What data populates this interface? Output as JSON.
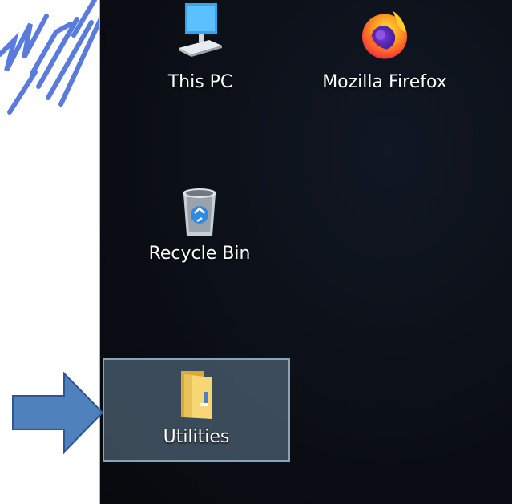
{
  "desktop": {
    "icons": [
      {
        "label": "This PC",
        "icon": "this-pc-icon"
      },
      {
        "label": "Mozilla Firefox",
        "icon": "firefox-icon"
      },
      {
        "label": "Recycle Bin",
        "icon": "recycle-bin-icon"
      },
      {
        "label": "Utilities",
        "icon": "folder-icon",
        "selected": true
      }
    ],
    "wallpaper_color": "#0b0f16"
  },
  "annotation": {
    "arrow_color": "#4f81bd",
    "arrow_border_color": "#2f5597",
    "points_to": "Utilities"
  }
}
